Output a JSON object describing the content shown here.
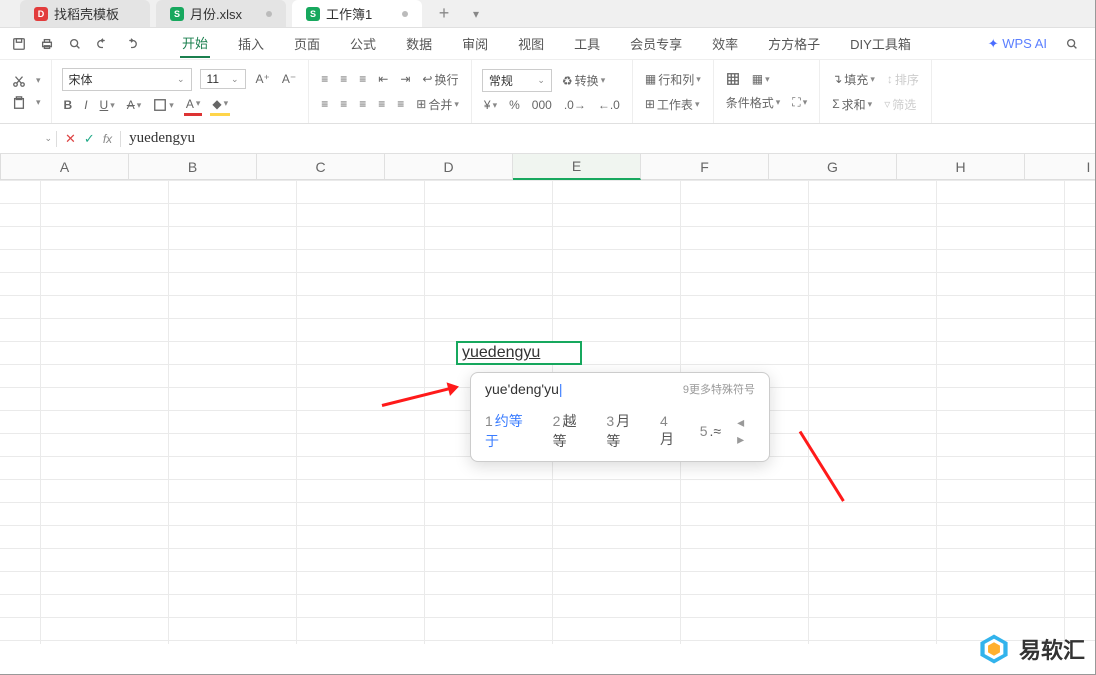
{
  "tabs": [
    {
      "label": "找稻壳模板",
      "type": "d",
      "modified": false
    },
    {
      "label": "月份.xlsx",
      "type": "s",
      "modified": true
    },
    {
      "label": "工作簿1",
      "type": "s",
      "modified": true,
      "active": true
    }
  ],
  "menu": {
    "items": [
      "开始",
      "插入",
      "页面",
      "公式",
      "数据",
      "审阅",
      "视图",
      "工具",
      "会员专享",
      "效率",
      "方方格子",
      "DIY工具箱"
    ],
    "active": "开始"
  },
  "ai_label": "WPS AI",
  "font": {
    "name": "宋体",
    "size": "11"
  },
  "ribbon": {
    "wrap": "换行",
    "merge": "合并",
    "format_num": "常规",
    "convert": "转换",
    "rowcol": "行和列",
    "worksheet": "工作表",
    "cond_fmt": "条件格式",
    "fill": "填充",
    "sum": "求和",
    "sort": "排序",
    "filter": "筛选"
  },
  "formula_bar": {
    "value": "yuedengyu"
  },
  "columns": [
    "A",
    "B",
    "C",
    "D",
    "E",
    "F",
    "G",
    "H",
    "I"
  ],
  "active_col": "E",
  "cell_edit": {
    "text": "yuedengyu",
    "col": 4,
    "row": 7
  },
  "ime": {
    "input": "yue'deng'yu",
    "hint": "9更多特殊符号",
    "candidates": [
      {
        "n": "1",
        "t": "约等于",
        "active": true
      },
      {
        "n": "2",
        "t": "越等"
      },
      {
        "n": "3",
        "t": "月等"
      },
      {
        "n": "4",
        "t": "月"
      },
      {
        "n": "5",
        "t": "≈"
      }
    ]
  },
  "watermark": "易软汇"
}
